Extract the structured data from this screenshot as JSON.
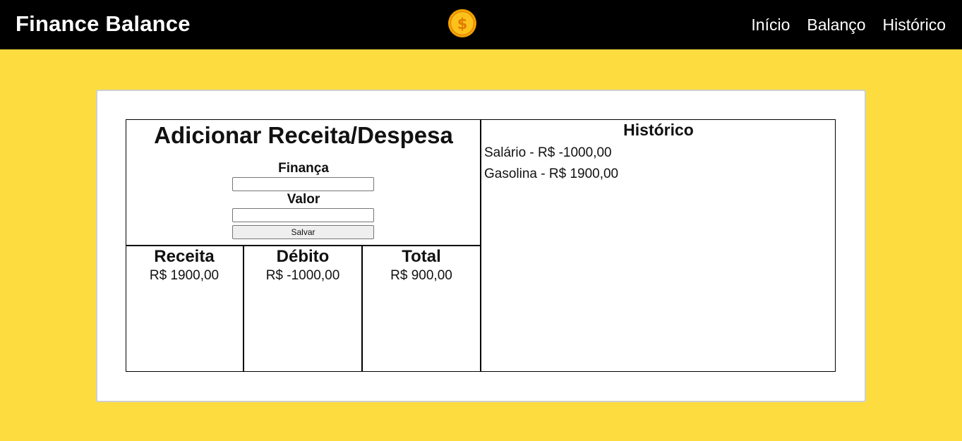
{
  "header": {
    "brand": "Finance Balance",
    "logo_icon": "dollar-coin-icon",
    "nav": [
      "Início",
      "Balanço",
      "Histórico"
    ]
  },
  "form": {
    "title": "Adicionar Receita/Despesa",
    "finance_label": "Finança",
    "finance_value": "",
    "value_label": "Valor",
    "value_value": "",
    "save_label": "Salvar"
  },
  "summary": {
    "income_title": "Receita",
    "income_value": "R$ 1900,00",
    "debit_title": "Débito",
    "debit_value": "R$ -1000,00",
    "total_title": "Total",
    "total_value": "R$ 900,00"
  },
  "history": {
    "title": "Histórico",
    "items": [
      "Salário - R$ -1000,00",
      "Gasolina - R$ 1900,00"
    ]
  },
  "colors": {
    "background": "#fddc3f",
    "header": "#000000",
    "card": "#ffffff",
    "coin": "#f5a300"
  }
}
